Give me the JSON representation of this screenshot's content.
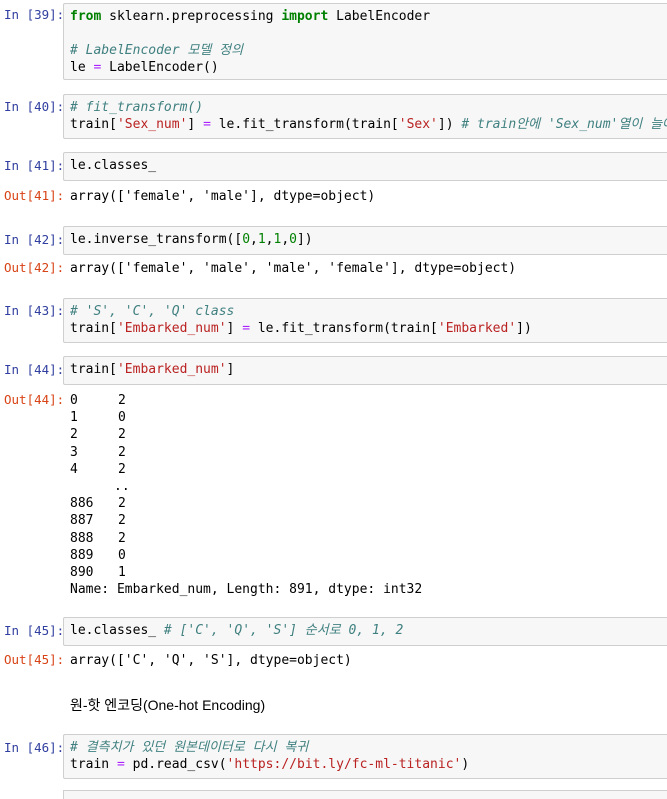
{
  "cells": {
    "c39": {
      "prompt": "In [39]:",
      "line1": {
        "kw1": "from",
        "mod": " sklearn.preprocessing ",
        "kw2": "import",
        "name": " LabelEncoder"
      },
      "line3": "# LabelEncoder 모델 정의",
      "line4": {
        "var": "le ",
        "op": "=",
        "rest": " LabelEncoder()"
      }
    },
    "c40": {
      "prompt": "In [40]:",
      "line1": "# fit_transform()",
      "line2": {
        "a": "train[",
        "s1": "'Sex_num'",
        "b": "] ",
        "op": "=",
        "c": " le.fit_transform(train[",
        "s2": "'Sex'",
        "d": "]) ",
        "comment": "# train안에 'Sex_num'열이 늘어남"
      }
    },
    "c41": {
      "prompt": "In [41]:",
      "code": "le.classes_",
      "out_prompt": "Out[41]:",
      "output": "array(['female', 'male'], dtype=object)"
    },
    "c42": {
      "prompt": "In [42]:",
      "code": {
        "a": "le.inverse_transform([",
        "n1": "0",
        "c1": ",",
        "n2": "1",
        "c2": ",",
        "n3": "1",
        "c3": ",",
        "n4": "0",
        "b": "])"
      },
      "out_prompt": "Out[42]:",
      "output": "array(['female', 'male', 'male', 'female'], dtype=object)"
    },
    "c43": {
      "prompt": "In [43]:",
      "line1": "# 'S', 'C', 'Q' class",
      "line2": {
        "a": "train[",
        "s1": "'Embarked_num'",
        "b": "] ",
        "op": "=",
        "c": " le.fit_transform(train[",
        "s2": "'Embarked'",
        "d": "])"
      }
    },
    "c44": {
      "prompt": "In [44]:",
      "code": {
        "a": "train[",
        "s1": "'Embarked_num'",
        "b": "]"
      },
      "out_prompt": "Out[44]:",
      "rows_top": [
        {
          "idx": "0",
          "val": "2"
        },
        {
          "idx": "1",
          "val": "0"
        },
        {
          "idx": "2",
          "val": "2"
        },
        {
          "idx": "3",
          "val": "2"
        },
        {
          "idx": "4",
          "val": "2"
        }
      ],
      "ellipsis": "..",
      "rows_bottom": [
        {
          "idx": "886",
          "val": "2"
        },
        {
          "idx": "887",
          "val": "2"
        },
        {
          "idx": "888",
          "val": "2"
        },
        {
          "idx": "889",
          "val": "0"
        },
        {
          "idx": "890",
          "val": "1"
        }
      ],
      "footer": "Name: Embarked_num, Length: 891, dtype: int32"
    },
    "c45": {
      "prompt": "In [45]:",
      "code": {
        "a": "le.classes_ ",
        "comment": "# ['C', 'Q', 'S'] 순서로 0, 1, 2"
      },
      "out_prompt": "Out[45]:",
      "output": "array(['C', 'Q', 'S'], dtype=object)"
    },
    "markdown": {
      "text": "원-핫 엔코딩(One-hot Encoding)"
    },
    "c46": {
      "prompt": "In [46]:",
      "line1": "# 결측치가 있던 원본데이터로 다시 복귀",
      "line2": {
        "a": "train ",
        "op": "=",
        "b": " pd.read_csv(",
        "s": "'https://bit.ly/fc-ml-titanic'",
        "c": ")"
      }
    }
  }
}
